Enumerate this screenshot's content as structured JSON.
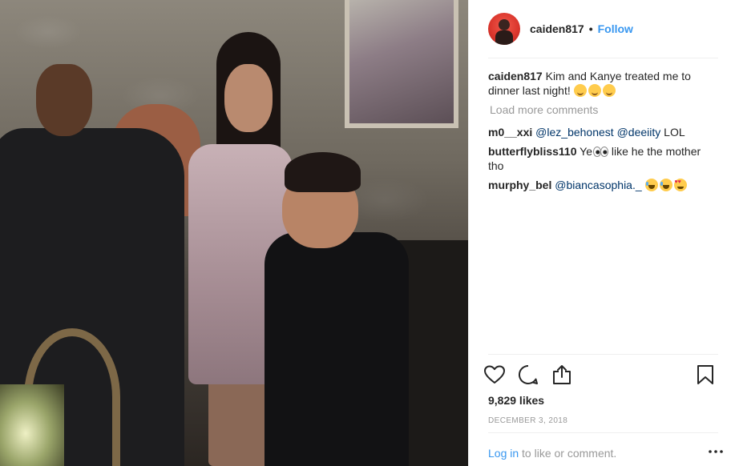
{
  "post": {
    "author": {
      "username": "caiden817",
      "separator": "•",
      "follow_label": "Follow"
    },
    "caption": {
      "username": "caiden817",
      "text": "Kim and Kanye treated me to dinner last night!",
      "emojis": [
        "smiling-face-icon",
        "smiling-face-icon",
        "smiling-face-icon"
      ]
    },
    "load_more_label": "Load more comments",
    "comments": [
      {
        "username": "m0__xxi",
        "mention_1": "@lez_behonest",
        "mention_2": "@deeiity",
        "text": "LOL"
      },
      {
        "username": "butterflybliss110",
        "text_before": "Ye",
        "text_after": "like he the mother tho",
        "emoji": "eyes-icon"
      },
      {
        "username": "murphy_bel",
        "mention": "@biancasophia._",
        "emojis": [
          "tears-of-joy-icon",
          "tears-of-joy-icon",
          "heart-eyes-icon"
        ]
      }
    ],
    "actions": {
      "like_icon": "heart-icon",
      "comment_icon": "comment-icon",
      "share_icon": "share-icon",
      "save_icon": "bookmark-icon"
    },
    "likes_label": "9,829 likes",
    "date_label": "DECEMBER 3, 2018",
    "login": {
      "link_text": "Log in",
      "rest_text": "to like or comment."
    },
    "more_icon": "more-options-icon"
  },
  "colors": {
    "link": "#3897f0",
    "mention": "#003569",
    "muted": "#999999",
    "text": "#262626",
    "divider": "#efefef"
  }
}
